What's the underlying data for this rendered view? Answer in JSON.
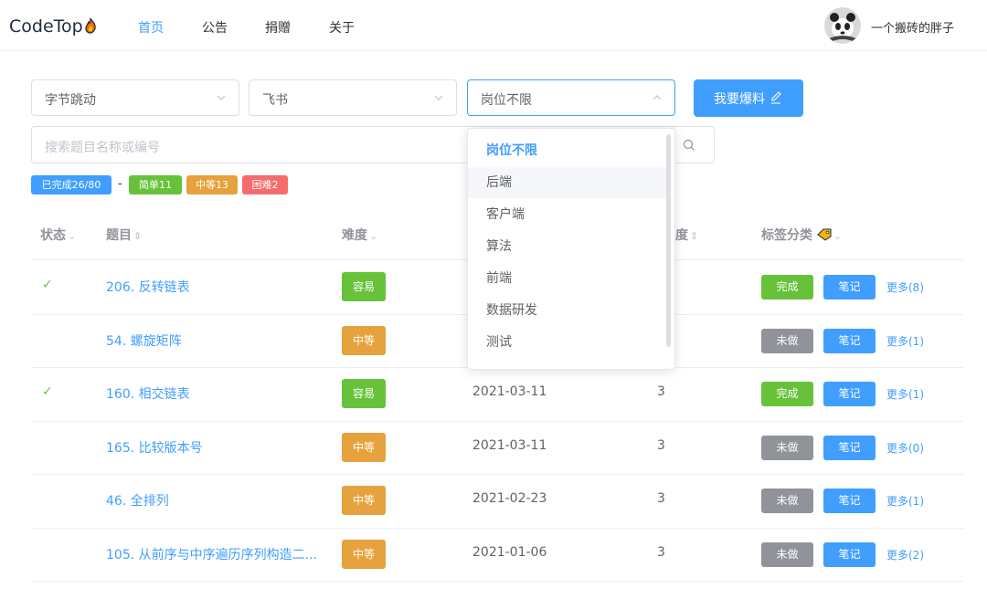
{
  "app": {
    "logo": "CodeTop",
    "nav": [
      "首页",
      "公告",
      "捐赠",
      "关于"
    ],
    "active_nav": 0,
    "user": "一个搬砖的胖子"
  },
  "filters": {
    "company": "字节跳动",
    "department": "飞书",
    "position": "岗位不限",
    "submit_label": "我要爆料",
    "search_placeholder": "搜索题目名称或编号"
  },
  "stats": {
    "done": "已完成26/80",
    "separator": "-",
    "easy": "简单11",
    "medium": "中等13",
    "hard": "困难2"
  },
  "table": {
    "headers": {
      "status": "状态",
      "title": "题目",
      "difficulty": "难度",
      "frequency_tail": "度",
      "tags": "标签分类"
    },
    "rows": [
      {
        "done": true,
        "title": "206. 反转链表",
        "difficulty": "容易",
        "level": "easy",
        "date": "",
        "freq": "",
        "status": "完成",
        "note": "笔记",
        "more": "更多(8)"
      },
      {
        "done": false,
        "title": "54. 螺旋矩阵",
        "difficulty": "中等",
        "level": "mid",
        "date": "",
        "freq": "",
        "status": "未做",
        "note": "笔记",
        "more": "更多(1)"
      },
      {
        "done": true,
        "title": "160. 相交链表",
        "difficulty": "容易",
        "level": "easy",
        "date": "2021-03-11",
        "freq": "3",
        "status": "完成",
        "note": "笔记",
        "more": "更多(1)"
      },
      {
        "done": false,
        "title": "165. 比较版本号",
        "difficulty": "中等",
        "level": "mid",
        "date": "2021-03-11",
        "freq": "3",
        "status": "未做",
        "note": "笔记",
        "more": "更多(0)"
      },
      {
        "done": false,
        "title": "46. 全排列",
        "difficulty": "中等",
        "level": "mid",
        "date": "2021-02-23",
        "freq": "3",
        "status": "未做",
        "note": "笔记",
        "more": "更多(1)"
      },
      {
        "done": false,
        "title": "105. 从前序与中序遍历序列构造二...",
        "difficulty": "中等",
        "level": "mid",
        "date": "2021-01-06",
        "freq": "3",
        "status": "未做",
        "note": "笔记",
        "more": "更多(2)"
      }
    ]
  },
  "dropdown": {
    "options": [
      "岗位不限",
      "后端",
      "客户端",
      "算法",
      "前端",
      "数据研发",
      "测试"
    ],
    "selected": 0,
    "hovered": 1
  },
  "colors": {
    "primary": "#409eff",
    "success": "#67c23a",
    "warning": "#e6a23c",
    "danger": "#f56c6c",
    "info": "#909399"
  }
}
